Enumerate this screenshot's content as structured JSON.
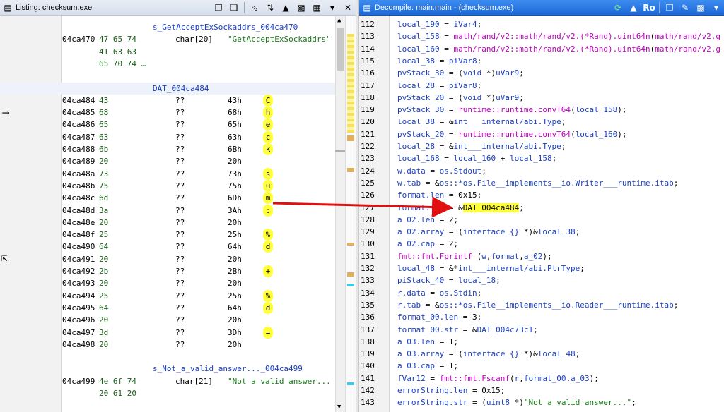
{
  "left": {
    "title": "Listing:  checksum.exe",
    "rows": [
      {
        "type": "label",
        "text": "s_GetAcceptExSockaddrs_004ca470"
      },
      {
        "type": "data",
        "addr": "04ca470",
        "bytes": "47 65 74",
        "mnem": "char[20]",
        "str": "\"GetAcceptExSockaddrs\""
      },
      {
        "type": "cont",
        "bytes": "41 63 63"
      },
      {
        "type": "cont",
        "bytes": "65 70 74 …"
      },
      {
        "type": "blank"
      },
      {
        "type": "label",
        "text": "DAT_004ca484"
      },
      {
        "type": "byte",
        "addr": "04ca484",
        "bytes": "43",
        "mnem": "??",
        "val": "43h",
        "cmt": "C"
      },
      {
        "type": "byte",
        "addr": "04ca485",
        "bytes": "68",
        "mnem": "??",
        "val": "68h",
        "cmt": "h"
      },
      {
        "type": "byte",
        "addr": "04ca486",
        "bytes": "65",
        "mnem": "??",
        "val": "65h",
        "cmt": "e"
      },
      {
        "type": "byte",
        "addr": "04ca487",
        "bytes": "63",
        "mnem": "??",
        "val": "63h",
        "cmt": "c"
      },
      {
        "type": "byte",
        "addr": "04ca488",
        "bytes": "6b",
        "mnem": "??",
        "val": "6Bh",
        "cmt": "k"
      },
      {
        "type": "byte",
        "addr": "04ca489",
        "bytes": "20",
        "mnem": "??",
        "val": "20h",
        "cmt": ""
      },
      {
        "type": "byte",
        "addr": "04ca48a",
        "bytes": "73",
        "mnem": "??",
        "val": "73h",
        "cmt": "s"
      },
      {
        "type": "byte",
        "addr": "04ca48b",
        "bytes": "75",
        "mnem": "??",
        "val": "75h",
        "cmt": "u"
      },
      {
        "type": "byte",
        "addr": "04ca48c",
        "bytes": "6d",
        "mnem": "??",
        "val": "6Dh",
        "cmt": "m"
      },
      {
        "type": "byte",
        "addr": "04ca48d",
        "bytes": "3a",
        "mnem": "??",
        "val": "3Ah",
        "cmt": ":"
      },
      {
        "type": "byte",
        "addr": "04ca48e",
        "bytes": "20",
        "mnem": "??",
        "val": "20h",
        "cmt": ""
      },
      {
        "type": "byte",
        "addr": "04ca48f",
        "bytes": "25",
        "mnem": "??",
        "val": "25h",
        "cmt": "%"
      },
      {
        "type": "byte",
        "addr": "04ca490",
        "bytes": "64",
        "mnem": "??",
        "val": "64h",
        "cmt": "d"
      },
      {
        "type": "byte",
        "addr": "04ca491",
        "bytes": "20",
        "mnem": "??",
        "val": "20h",
        "cmt": ""
      },
      {
        "type": "byte",
        "addr": "04ca492",
        "bytes": "2b",
        "mnem": "??",
        "val": "2Bh",
        "cmt": "+"
      },
      {
        "type": "byte",
        "addr": "04ca493",
        "bytes": "20",
        "mnem": "??",
        "val": "20h",
        "cmt": ""
      },
      {
        "type": "byte",
        "addr": "04ca494",
        "bytes": "25",
        "mnem": "??",
        "val": "25h",
        "cmt": "%"
      },
      {
        "type": "byte",
        "addr": "04ca495",
        "bytes": "64",
        "mnem": "??",
        "val": "64h",
        "cmt": "d"
      },
      {
        "type": "byte",
        "addr": "04ca496",
        "bytes": "20",
        "mnem": "??",
        "val": "20h",
        "cmt": ""
      },
      {
        "type": "byte",
        "addr": "04ca497",
        "bytes": "3d",
        "mnem": "??",
        "val": "3Dh",
        "cmt": "="
      },
      {
        "type": "byte",
        "addr": "04ca498",
        "bytes": "20",
        "mnem": "??",
        "val": "20h",
        "cmt": ""
      },
      {
        "type": "blank"
      },
      {
        "type": "label",
        "text": "s_Not_a_valid_answer..._004ca499"
      },
      {
        "type": "data",
        "addr": "04ca499",
        "bytes": "4e 6f 74",
        "mnem": "char[21]",
        "str": "\"Not a valid answer..."
      },
      {
        "type": "cont",
        "bytes": "20 61 20"
      }
    ]
  },
  "right": {
    "title": "Decompile: main.main - (checksum.exe)",
    "lines": [
      {
        "n": "112",
        "code": [
          [
            "var",
            "local_190"
          ],
          [
            "",
            "= "
          ],
          [
            "var",
            "iVar4"
          ],
          [
            "",
            ";"
          ]
        ]
      },
      {
        "n": "113",
        "code": [
          [
            "var",
            "local_158"
          ],
          [
            "",
            ""
          ],
          [
            "",
            "= "
          ],
          [
            "fn",
            "math/rand/v2::math/rand/v2.(*Rand).uint64n"
          ],
          [
            "",
            "("
          ],
          [
            "fn",
            "math/rand/v2.g"
          ]
        ]
      },
      {
        "n": "114",
        "code": [
          [
            "var",
            "local_160"
          ],
          [
            "",
            "= "
          ],
          [
            "fn",
            "math/rand/v2::math/rand/v2.(*Rand).uint64n"
          ],
          [
            "",
            "("
          ],
          [
            "fn",
            "math/rand/v2.g"
          ]
        ]
      },
      {
        "n": "115",
        "code": [
          [
            "var",
            "local_38"
          ],
          [
            "",
            "= "
          ],
          [
            "var",
            "piVar8"
          ],
          [
            "",
            ";"
          ]
        ]
      },
      {
        "n": "116",
        "code": [
          [
            "var",
            "pvStack_30"
          ],
          [
            "",
            "= ("
          ],
          [
            "ty",
            "void"
          ],
          [
            "",
            " *)"
          ],
          [
            "var",
            "uVar9"
          ],
          [
            "",
            ";"
          ]
        ]
      },
      {
        "n": "117",
        "code": [
          [
            "var",
            "local_28"
          ],
          [
            "",
            "= "
          ],
          [
            "var",
            "piVar8"
          ],
          [
            "",
            ";"
          ]
        ]
      },
      {
        "n": "118",
        "code": [
          [
            "var",
            "pvStack_20"
          ],
          [
            "",
            "= ("
          ],
          [
            "ty",
            "void"
          ],
          [
            "",
            " *)"
          ],
          [
            "var",
            "uVar9"
          ],
          [
            "",
            ";"
          ]
        ]
      },
      {
        "n": "119",
        "code": [
          [
            "var",
            "pvStack_30"
          ],
          [
            "",
            "= "
          ],
          [
            "fn",
            "runtime::runtime.convT64"
          ],
          [
            "",
            "("
          ],
          [
            "var",
            "local_158"
          ],
          [
            "",
            ");"
          ]
        ]
      },
      {
        "n": "120",
        "code": [
          [
            "var",
            "local_38"
          ],
          [
            "",
            "= &"
          ],
          [
            "var",
            "int___internal/abi.Type"
          ],
          [
            "",
            ";"
          ]
        ]
      },
      {
        "n": "121",
        "code": [
          [
            "var",
            "pvStack_20"
          ],
          [
            "",
            "= "
          ],
          [
            "fn",
            "runtime::runtime.convT64"
          ],
          [
            "",
            "("
          ],
          [
            "var",
            "local_160"
          ],
          [
            "",
            ");"
          ]
        ]
      },
      {
        "n": "122",
        "code": [
          [
            "var",
            "local_28"
          ],
          [
            "",
            "= &"
          ],
          [
            "var",
            "int___internal/abi.Type"
          ],
          [
            "",
            ";"
          ]
        ]
      },
      {
        "n": "123",
        "code": [
          [
            "var",
            "local_168"
          ],
          [
            "",
            "= "
          ],
          [
            "var",
            "local_160"
          ],
          [
            "",
            " + "
          ],
          [
            "var",
            "local_158"
          ],
          [
            "",
            ";"
          ]
        ]
      },
      {
        "n": "124",
        "code": [
          [
            "var",
            "w.data"
          ],
          [
            "",
            "= "
          ],
          [
            "var",
            "os.Stdout"
          ],
          [
            "",
            ";"
          ]
        ]
      },
      {
        "n": "125",
        "code": [
          [
            "var",
            "w.tab"
          ],
          [
            "",
            "= &"
          ],
          [
            "var",
            "os::*os.File__implements__io.Writer___runtime.itab"
          ],
          [
            "",
            ";"
          ]
        ]
      },
      {
        "n": "126",
        "code": [
          [
            "var",
            "format.len"
          ],
          [
            "",
            "= 0x15;"
          ]
        ]
      },
      {
        "n": "127",
        "code": [
          [
            "var",
            "format.str"
          ],
          [
            "",
            "= &"
          ],
          [
            "hl",
            "DAT_004ca484"
          ],
          [
            "",
            ";"
          ]
        ]
      },
      {
        "n": "128",
        "code": [
          [
            "var",
            "a_02.len"
          ],
          [
            "",
            "= 2;"
          ]
        ]
      },
      {
        "n": "129",
        "code": [
          [
            "var",
            "a_02.array"
          ],
          [
            "",
            "= ("
          ],
          [
            "ty",
            "interface_{}"
          ],
          [
            "",
            " *)&"
          ],
          [
            "var",
            "local_38"
          ],
          [
            "",
            ";"
          ]
        ]
      },
      {
        "n": "130",
        "code": [
          [
            "var",
            "a_02.cap"
          ],
          [
            "",
            "= 2;"
          ]
        ]
      },
      {
        "n": "131",
        "code": [
          [
            "fn",
            "fmt::fmt.Fprintf"
          ],
          [
            "",
            "("
          ],
          [
            "var",
            "w"
          ],
          [
            "",
            ","
          ],
          [
            "var",
            "format"
          ],
          [
            "",
            ","
          ],
          [
            "var",
            "a_02"
          ],
          [
            "",
            ");"
          ]
        ]
      },
      {
        "n": "132",
        "code": [
          [
            "var",
            "local_48"
          ],
          [
            "",
            "= &*"
          ],
          [
            "var",
            "int___internal/abi.PtrType"
          ],
          [
            "",
            ";"
          ]
        ]
      },
      {
        "n": "133",
        "code": [
          [
            "var",
            "piStack_40"
          ],
          [
            "",
            "= "
          ],
          [
            "var",
            "local_18"
          ],
          [
            "",
            ";"
          ]
        ]
      },
      {
        "n": "134",
        "code": [
          [
            "var",
            "r.data"
          ],
          [
            "",
            "= "
          ],
          [
            "var",
            "os.Stdin"
          ],
          [
            "",
            ";"
          ]
        ]
      },
      {
        "n": "135",
        "code": [
          [
            "var",
            "r.tab"
          ],
          [
            "",
            "= &"
          ],
          [
            "var",
            "os::*os.File__implements__io.Reader___runtime.itab"
          ],
          [
            "",
            ";"
          ]
        ]
      },
      {
        "n": "136",
        "code": [
          [
            "var",
            "format_00.len"
          ],
          [
            "",
            "= 3;"
          ]
        ]
      },
      {
        "n": "137",
        "code": [
          [
            "var",
            "format_00.str"
          ],
          [
            "",
            "= &"
          ],
          [
            "var",
            "DAT_004c73c1"
          ],
          [
            "",
            ";"
          ]
        ]
      },
      {
        "n": "138",
        "code": [
          [
            "var",
            "a_03.len"
          ],
          [
            "",
            "= 1;"
          ]
        ]
      },
      {
        "n": "139",
        "code": [
          [
            "var",
            "a_03.array"
          ],
          [
            "",
            "= ("
          ],
          [
            "ty",
            "interface_{}"
          ],
          [
            "",
            " *)&"
          ],
          [
            "var",
            "local_48"
          ],
          [
            "",
            ";"
          ]
        ]
      },
      {
        "n": "140",
        "code": [
          [
            "var",
            "a_03.cap"
          ],
          [
            "",
            "= 1;"
          ]
        ]
      },
      {
        "n": "141",
        "code": [
          [
            "var",
            "fVar12"
          ],
          [
            "",
            "= "
          ],
          [
            "fn",
            "fmt::fmt.Fscanf"
          ],
          [
            "",
            "("
          ],
          [
            "var",
            "r"
          ],
          [
            "",
            ","
          ],
          [
            "var",
            "format_00"
          ],
          [
            "",
            ","
          ],
          [
            "var",
            "a_03"
          ],
          [
            "",
            ");"
          ]
        ]
      },
      {
        "n": "142",
        "code": [
          [
            "var",
            "errorString.len"
          ],
          [
            "",
            "= 0x15;"
          ]
        ]
      },
      {
        "n": "143",
        "code": [
          [
            "var",
            "errorString.str"
          ],
          [
            "",
            "= ("
          ],
          [
            "ty",
            "uint8"
          ],
          [
            "",
            " *)"
          ],
          [
            "str",
            "\"Not a valid answer...\""
          ],
          [
            "",
            ";"
          ]
        ]
      }
    ]
  },
  "colors": {
    "highlight": "#ffff3a",
    "arrow": "#e01010",
    "accent": "#1d68d6"
  }
}
